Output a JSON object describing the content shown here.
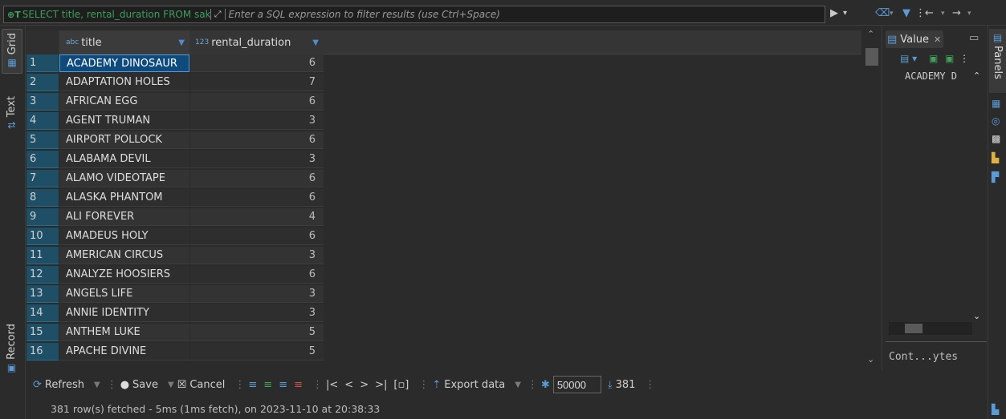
{
  "filter": {
    "query": "SELECT title, rental_duration FROM sakila.f",
    "placeholder": "Enter a SQL expression to filter results (use Ctrl+Space)"
  },
  "left_tabs": {
    "grid": "Grid",
    "text": "Text",
    "record": "Record"
  },
  "columns": [
    {
      "name": "title",
      "type_badge": "abc"
    },
    {
      "name": "rental_duration",
      "type_badge": "123"
    }
  ],
  "rows": [
    {
      "n": "1",
      "title": "ACADEMY DINOSAUR",
      "dur": "6"
    },
    {
      "n": "2",
      "title": "ADAPTATION HOLES",
      "dur": "7"
    },
    {
      "n": "3",
      "title": "AFRICAN EGG",
      "dur": "6"
    },
    {
      "n": "4",
      "title": "AGENT TRUMAN",
      "dur": "3"
    },
    {
      "n": "5",
      "title": "AIRPORT POLLOCK",
      "dur": "6"
    },
    {
      "n": "6",
      "title": "ALABAMA DEVIL",
      "dur": "3"
    },
    {
      "n": "7",
      "title": "ALAMO VIDEOTAPE",
      "dur": "6"
    },
    {
      "n": "8",
      "title": "ALASKA PHANTOM",
      "dur": "6"
    },
    {
      "n": "9",
      "title": "ALI FOREVER",
      "dur": "4"
    },
    {
      "n": "10",
      "title": "AMADEUS HOLY",
      "dur": "6"
    },
    {
      "n": "11",
      "title": "AMERICAN CIRCUS",
      "dur": "3"
    },
    {
      "n": "12",
      "title": "ANALYZE HOOSIERS",
      "dur": "6"
    },
    {
      "n": "13",
      "title": "ANGELS LIFE",
      "dur": "3"
    },
    {
      "n": "14",
      "title": "ANNIE IDENTITY",
      "dur": "3"
    },
    {
      "n": "15",
      "title": "ANTHEM LUKE",
      "dur": "5"
    },
    {
      "n": "16",
      "title": "APACHE DIVINE",
      "dur": "5"
    }
  ],
  "value_panel": {
    "tab_label": "Value",
    "value": "ACADEMY D",
    "content_label": "Cont...ytes"
  },
  "right_panel": {
    "label": "Panels"
  },
  "toolbar": {
    "refresh": "Refresh",
    "save": "Save",
    "cancel": "Cancel",
    "export": "Export data",
    "fetch_size": "50000",
    "row_count": "381"
  },
  "status": "381 row(s) fetched - 5ms (1ms fetch), on 2023-11-10 at 20:38:33",
  "colors": {
    "accent": "#5a9bd6",
    "selected_row": "#0e4a7c",
    "rownum_bg": "#1f4f66",
    "query_green": "#3c9f5a"
  }
}
